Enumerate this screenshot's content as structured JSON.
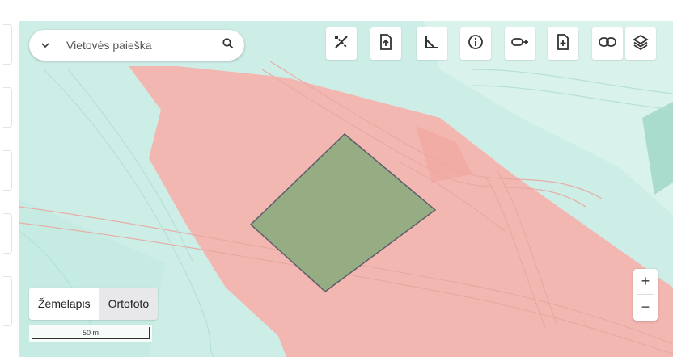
{
  "search": {
    "placeholder": "Vietovės paieška"
  },
  "toolbar": {
    "buttons": [
      {
        "name": "edit-tools",
        "icon": "pencil-ruler-cross-icon"
      },
      {
        "name": "upload-file",
        "icon": "file-upload-icon"
      },
      {
        "name": "measure",
        "icon": "angle-measure-icon"
      },
      {
        "name": "info",
        "icon": "info-icon"
      },
      {
        "name": "link-add",
        "icon": "link-add-icon"
      },
      {
        "name": "add-file",
        "icon": "file-add-icon"
      },
      {
        "name": "link",
        "icon": "link-icon"
      },
      {
        "name": "layers",
        "icon": "layers-icon"
      }
    ]
  },
  "map_type": {
    "options": [
      "Žemėlapis",
      "Ortofoto"
    ],
    "selected": "Žemėlapis"
  },
  "scale_bar": {
    "label": "50 m"
  },
  "zoom": {
    "in_label": "+",
    "out_label": "−"
  },
  "colors": {
    "teal_base": "#cdeee6",
    "zone_red": "#f3b7b1",
    "parcel_green": "#96ad84",
    "parcel_outline": "#5e5e6a",
    "icon_color": "#333333"
  }
}
